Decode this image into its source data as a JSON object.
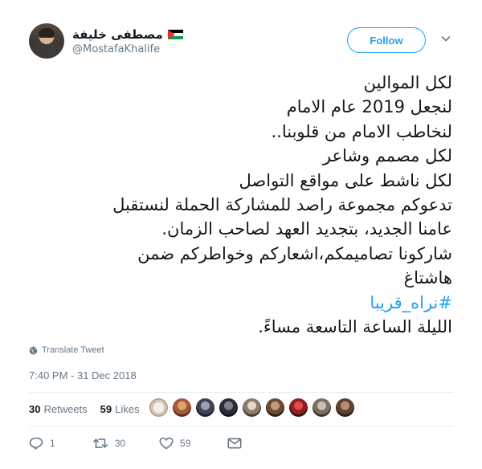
{
  "header": {
    "display_name": "مصطفى خليفة",
    "handle": "@MostafaKhalife",
    "follow_label": "Follow"
  },
  "icons": {
    "flag": "palestine-flag-icon",
    "more": "chevron-down-icon",
    "translate": "globe-icon",
    "reply": "reply-icon",
    "retweet": "retweet-icon",
    "like": "heart-icon",
    "dm": "envelope-icon"
  },
  "tweet": {
    "lines": [
      "لكل الموالين",
      "لنجعل 2019 عام الامام",
      "لنخاطب الامام من قلوبنا..",
      "لكل مصمم وشاعر",
      "لكل ناشط على مواقع التواصل",
      "تدعوكم مجموعة راصد  للمشاركة الحملة لنستقبل",
      "عامنا الجديد، بتجديد العهد لصاحب الزمان.",
      "شاركونا تصاميمكم،اشعاركم وخواطركم ضمن",
      "هاشتاغ",
      "#نراه_قريبا",
      "الليلة الساعة التاسعة مساءً."
    ],
    "translate_label": "Translate Tweet",
    "timestamp": "7:40 PM - 31 Dec 2018"
  },
  "stats": {
    "retweets_count": "30",
    "retweets_label": "Retweets",
    "likes_count": "59",
    "likes_label": "Likes"
  },
  "actions": {
    "reply_count": "1",
    "retweet_count": "30",
    "like_count": "59"
  },
  "colors": {
    "accent": "#1da1f2",
    "muted": "#657786",
    "text": "#14171a",
    "divider": "#e6ecf0"
  }
}
